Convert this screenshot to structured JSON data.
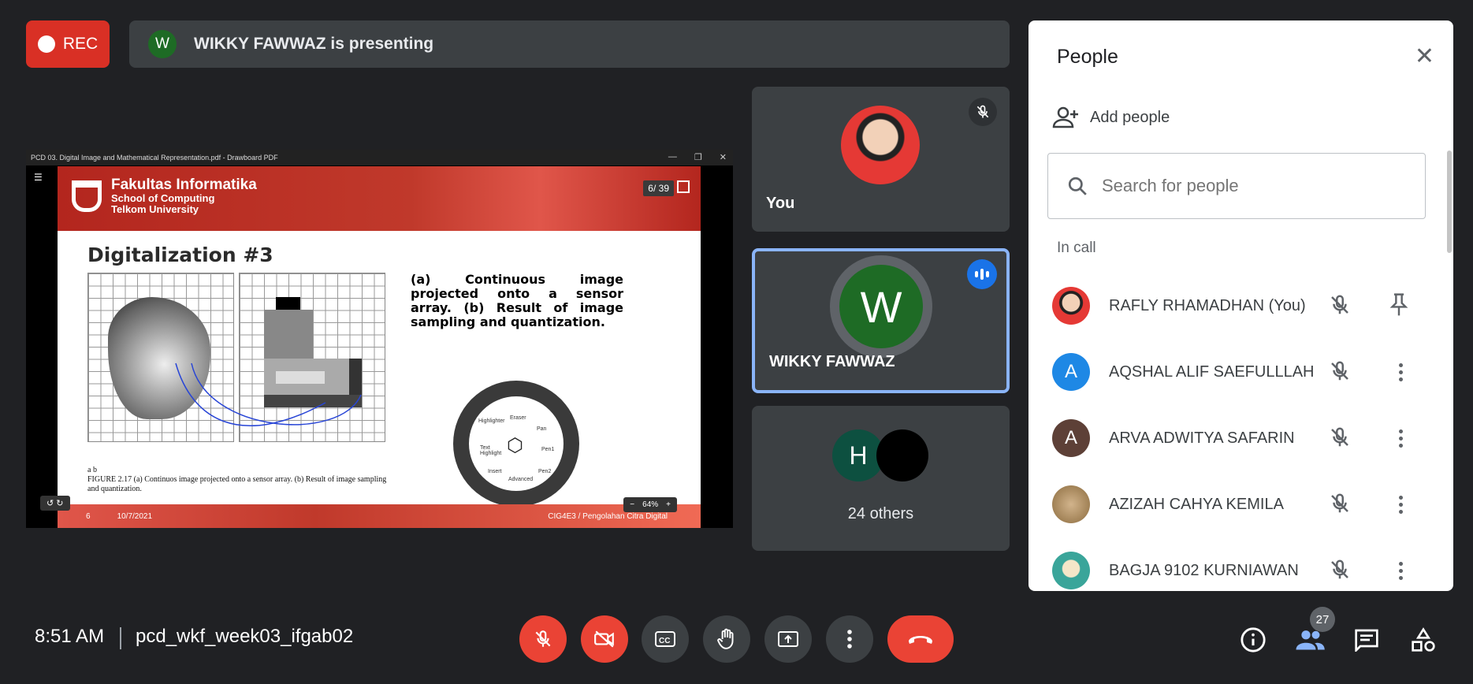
{
  "rec": {
    "label": "REC"
  },
  "presenter": {
    "initial": "W",
    "text": "WIKKY FAWWAZ is presenting"
  },
  "shared": {
    "window_title": "PCD 03. Digital Image and Mathematical Representation.pdf - Drawboard PDF",
    "page_indicator": "6/ 39",
    "banner_line1": "Fakultas Informatika",
    "banner_line2": "School of Computing",
    "banner_line3": "Telkom University",
    "heading": "Digitalization #3",
    "caption": "(a) Continuous image projected onto a sensor array. (b) Result of image sampling and quantization.",
    "fig_label": "a b",
    "fig_caption": "FIGURE 2.17 (a) Continuos image projected onto a sensor array. (b) Result of image sampling and quantization.",
    "footer_page": "6",
    "footer_date": "10/7/2021",
    "footer_course": "CIG4E3 / Pengolahan Citra Digital",
    "zoom": "64%",
    "wheel_items": [
      "Highlighter",
      "Eraser",
      "Pan",
      "Text Highlight",
      "Pen1",
      "Insert",
      "Advanced",
      "Pen2"
    ]
  },
  "tiles": {
    "you": {
      "name": "You"
    },
    "wikky": {
      "initial": "W",
      "name": "WIKKY FAWWAZ"
    },
    "others": {
      "initial": "H",
      "label": "24 others"
    }
  },
  "panel": {
    "title": "People",
    "add_people": "Add people",
    "search_placeholder": "Search for people",
    "in_call": "In call",
    "participants": [
      {
        "name": "RAFLY RHAMADHAN (You)",
        "initial": "",
        "color": "#e53935"
      },
      {
        "name": "AQSHAL ALIF SAEFULLLAH",
        "initial": "A",
        "color": "#1e88e5"
      },
      {
        "name": "ARVA ADWITYA SAFARIN",
        "initial": "A",
        "color": "#5d4037"
      },
      {
        "name": "AZIZAH CAHYA KEMILA",
        "initial": "",
        "color": "#b89868"
      },
      {
        "name": "BAGJA 9102 KURNIAWAN",
        "initial": "",
        "color": "#3aa59a"
      }
    ]
  },
  "bottom": {
    "time": "8:51 AM",
    "meeting_code": "pcd_wkf_week03_ifgab02",
    "people_count": "27"
  },
  "colors": {
    "background": "#202124",
    "red": "#ea4335",
    "accent": "#8ab4f8",
    "tile": "#3c4043"
  }
}
